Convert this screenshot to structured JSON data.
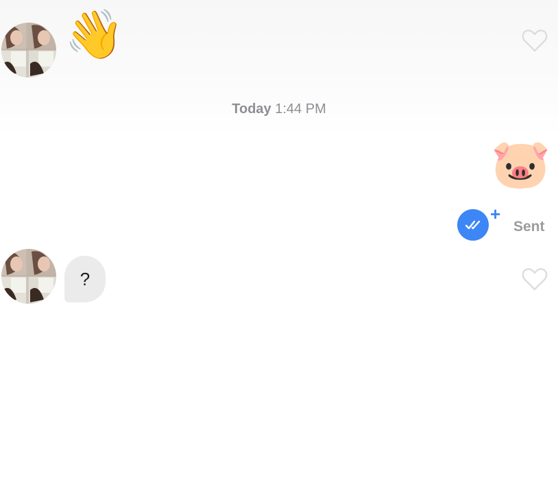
{
  "timestamp": {
    "day": "Today",
    "time": "1:44 PM"
  },
  "messages": [
    {
      "sender": "other",
      "content": "👋",
      "icons": [
        "avatar",
        "heart-outline-icon"
      ]
    },
    {
      "sender": "self",
      "content": "🐷"
    },
    {
      "sender": "other",
      "content": "?",
      "icons": [
        "avatar",
        "heart-outline-icon"
      ]
    }
  ],
  "status": {
    "label": "Sent",
    "plus": "+",
    "icon": "double-check-icon",
    "color": "#3d86f5"
  }
}
